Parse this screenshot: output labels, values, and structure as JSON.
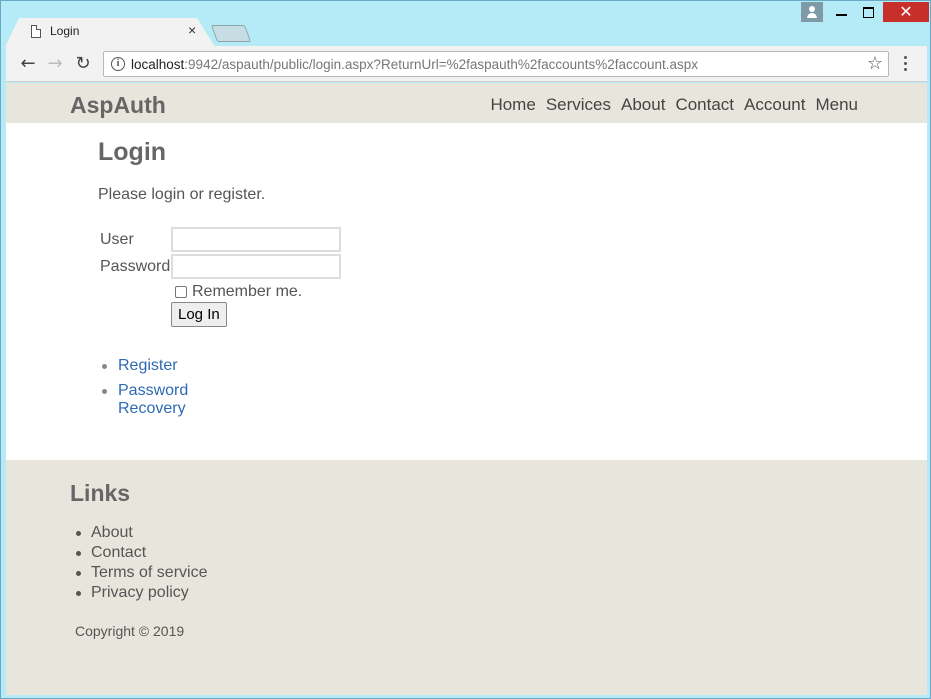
{
  "browser": {
    "tab_title": "Login",
    "close_glyph": "×",
    "url_host": "localhost",
    "url_rest": ":9942/aspauth/public/login.aspx?ReturnUrl=%2faspauth%2faccounts%2faccount.aspx",
    "window_close_glyph": "✕"
  },
  "site": {
    "brand": "AspAuth",
    "nav": [
      "Home",
      "Services",
      "About",
      "Contact",
      "Account",
      "Menu"
    ]
  },
  "login": {
    "title": "Login",
    "intro": "Please login or register.",
    "user_label": "User",
    "password_label": "Password",
    "user_value": "",
    "password_value": "",
    "remember_label": "Remember me.",
    "remember_checked": false,
    "submit_label": "Log In",
    "links": [
      "Register",
      "Password Recovery"
    ]
  },
  "footer": {
    "title": "Links",
    "links": [
      "About",
      "Contact",
      "Terms of service",
      "Privacy policy"
    ],
    "copyright": "Copyright © 2019"
  },
  "colors": {
    "header_bg": "#e8e5dc",
    "link": "#2d6ab4",
    "window_frame": "#b4ebf7",
    "close_red": "#c7302a"
  }
}
